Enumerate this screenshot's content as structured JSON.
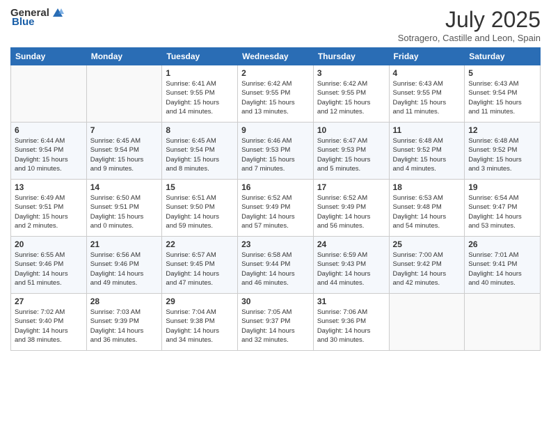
{
  "header": {
    "logo_general": "General",
    "logo_blue": "Blue",
    "month": "July 2025",
    "location": "Sotragero, Castille and Leon, Spain"
  },
  "weekdays": [
    "Sunday",
    "Monday",
    "Tuesday",
    "Wednesday",
    "Thursday",
    "Friday",
    "Saturday"
  ],
  "weeks": [
    [
      {
        "day": "",
        "lines": []
      },
      {
        "day": "",
        "lines": []
      },
      {
        "day": "1",
        "lines": [
          "Sunrise: 6:41 AM",
          "Sunset: 9:55 PM",
          "Daylight: 15 hours",
          "and 14 minutes."
        ]
      },
      {
        "day": "2",
        "lines": [
          "Sunrise: 6:42 AM",
          "Sunset: 9:55 PM",
          "Daylight: 15 hours",
          "and 13 minutes."
        ]
      },
      {
        "day": "3",
        "lines": [
          "Sunrise: 6:42 AM",
          "Sunset: 9:55 PM",
          "Daylight: 15 hours",
          "and 12 minutes."
        ]
      },
      {
        "day": "4",
        "lines": [
          "Sunrise: 6:43 AM",
          "Sunset: 9:55 PM",
          "Daylight: 15 hours",
          "and 11 minutes."
        ]
      },
      {
        "day": "5",
        "lines": [
          "Sunrise: 6:43 AM",
          "Sunset: 9:54 PM",
          "Daylight: 15 hours",
          "and 11 minutes."
        ]
      }
    ],
    [
      {
        "day": "6",
        "lines": [
          "Sunrise: 6:44 AM",
          "Sunset: 9:54 PM",
          "Daylight: 15 hours",
          "and 10 minutes."
        ]
      },
      {
        "day": "7",
        "lines": [
          "Sunrise: 6:45 AM",
          "Sunset: 9:54 PM",
          "Daylight: 15 hours",
          "and 9 minutes."
        ]
      },
      {
        "day": "8",
        "lines": [
          "Sunrise: 6:45 AM",
          "Sunset: 9:54 PM",
          "Daylight: 15 hours",
          "and 8 minutes."
        ]
      },
      {
        "day": "9",
        "lines": [
          "Sunrise: 6:46 AM",
          "Sunset: 9:53 PM",
          "Daylight: 15 hours",
          "and 7 minutes."
        ]
      },
      {
        "day": "10",
        "lines": [
          "Sunrise: 6:47 AM",
          "Sunset: 9:53 PM",
          "Daylight: 15 hours",
          "and 5 minutes."
        ]
      },
      {
        "day": "11",
        "lines": [
          "Sunrise: 6:48 AM",
          "Sunset: 9:52 PM",
          "Daylight: 15 hours",
          "and 4 minutes."
        ]
      },
      {
        "day": "12",
        "lines": [
          "Sunrise: 6:48 AM",
          "Sunset: 9:52 PM",
          "Daylight: 15 hours",
          "and 3 minutes."
        ]
      }
    ],
    [
      {
        "day": "13",
        "lines": [
          "Sunrise: 6:49 AM",
          "Sunset: 9:51 PM",
          "Daylight: 15 hours",
          "and 2 minutes."
        ]
      },
      {
        "day": "14",
        "lines": [
          "Sunrise: 6:50 AM",
          "Sunset: 9:51 PM",
          "Daylight: 15 hours",
          "and 0 minutes."
        ]
      },
      {
        "day": "15",
        "lines": [
          "Sunrise: 6:51 AM",
          "Sunset: 9:50 PM",
          "Daylight: 14 hours",
          "and 59 minutes."
        ]
      },
      {
        "day": "16",
        "lines": [
          "Sunrise: 6:52 AM",
          "Sunset: 9:49 PM",
          "Daylight: 14 hours",
          "and 57 minutes."
        ]
      },
      {
        "day": "17",
        "lines": [
          "Sunrise: 6:52 AM",
          "Sunset: 9:49 PM",
          "Daylight: 14 hours",
          "and 56 minutes."
        ]
      },
      {
        "day": "18",
        "lines": [
          "Sunrise: 6:53 AM",
          "Sunset: 9:48 PM",
          "Daylight: 14 hours",
          "and 54 minutes."
        ]
      },
      {
        "day": "19",
        "lines": [
          "Sunrise: 6:54 AM",
          "Sunset: 9:47 PM",
          "Daylight: 14 hours",
          "and 53 minutes."
        ]
      }
    ],
    [
      {
        "day": "20",
        "lines": [
          "Sunrise: 6:55 AM",
          "Sunset: 9:46 PM",
          "Daylight: 14 hours",
          "and 51 minutes."
        ]
      },
      {
        "day": "21",
        "lines": [
          "Sunrise: 6:56 AM",
          "Sunset: 9:46 PM",
          "Daylight: 14 hours",
          "and 49 minutes."
        ]
      },
      {
        "day": "22",
        "lines": [
          "Sunrise: 6:57 AM",
          "Sunset: 9:45 PM",
          "Daylight: 14 hours",
          "and 47 minutes."
        ]
      },
      {
        "day": "23",
        "lines": [
          "Sunrise: 6:58 AM",
          "Sunset: 9:44 PM",
          "Daylight: 14 hours",
          "and 46 minutes."
        ]
      },
      {
        "day": "24",
        "lines": [
          "Sunrise: 6:59 AM",
          "Sunset: 9:43 PM",
          "Daylight: 14 hours",
          "and 44 minutes."
        ]
      },
      {
        "day": "25",
        "lines": [
          "Sunrise: 7:00 AM",
          "Sunset: 9:42 PM",
          "Daylight: 14 hours",
          "and 42 minutes."
        ]
      },
      {
        "day": "26",
        "lines": [
          "Sunrise: 7:01 AM",
          "Sunset: 9:41 PM",
          "Daylight: 14 hours",
          "and 40 minutes."
        ]
      }
    ],
    [
      {
        "day": "27",
        "lines": [
          "Sunrise: 7:02 AM",
          "Sunset: 9:40 PM",
          "Daylight: 14 hours",
          "and 38 minutes."
        ]
      },
      {
        "day": "28",
        "lines": [
          "Sunrise: 7:03 AM",
          "Sunset: 9:39 PM",
          "Daylight: 14 hours",
          "and 36 minutes."
        ]
      },
      {
        "day": "29",
        "lines": [
          "Sunrise: 7:04 AM",
          "Sunset: 9:38 PM",
          "Daylight: 14 hours",
          "and 34 minutes."
        ]
      },
      {
        "day": "30",
        "lines": [
          "Sunrise: 7:05 AM",
          "Sunset: 9:37 PM",
          "Daylight: 14 hours",
          "and 32 minutes."
        ]
      },
      {
        "day": "31",
        "lines": [
          "Sunrise: 7:06 AM",
          "Sunset: 9:36 PM",
          "Daylight: 14 hours",
          "and 30 minutes."
        ]
      },
      {
        "day": "",
        "lines": []
      },
      {
        "day": "",
        "lines": []
      }
    ]
  ]
}
